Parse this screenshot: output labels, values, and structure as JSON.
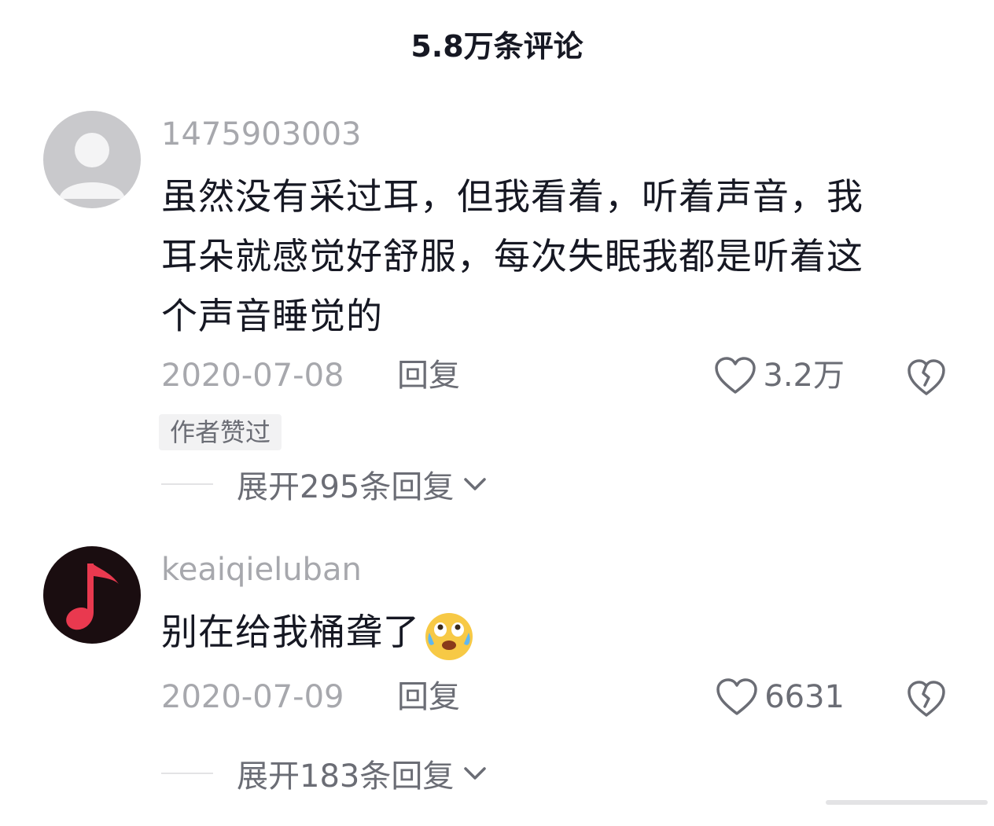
{
  "header": {
    "title": "5.8万条评论"
  },
  "comments": [
    {
      "username": "1475903003",
      "text_lines": [
        "虽然没有采过耳，但我看着，听着声音，我",
        "耳朵就感觉好舒服，每次失眠我都是听着这",
        "个声音睡觉的"
      ],
      "date": "2020-07-08",
      "reply_label": "回复",
      "like_count": "3.2万",
      "badge": "作者赞过",
      "expand_label": "展开295条回复",
      "avatar_icon": "default-user-avatar"
    },
    {
      "username": "keaiqieluban",
      "text": "别在给我桶聋了",
      "emoji_icon": "crying-laugh-emoji",
      "date": "2020-07-09",
      "reply_label": "回复",
      "like_count": "6631",
      "expand_label": "展开183条回复",
      "avatar_icon": "music-note-avatar"
    }
  ],
  "colors": {
    "text": "#161823",
    "muted": "#a7a8ad",
    "secondary": "#6b6d75",
    "avatar_note": "#e9394f"
  }
}
